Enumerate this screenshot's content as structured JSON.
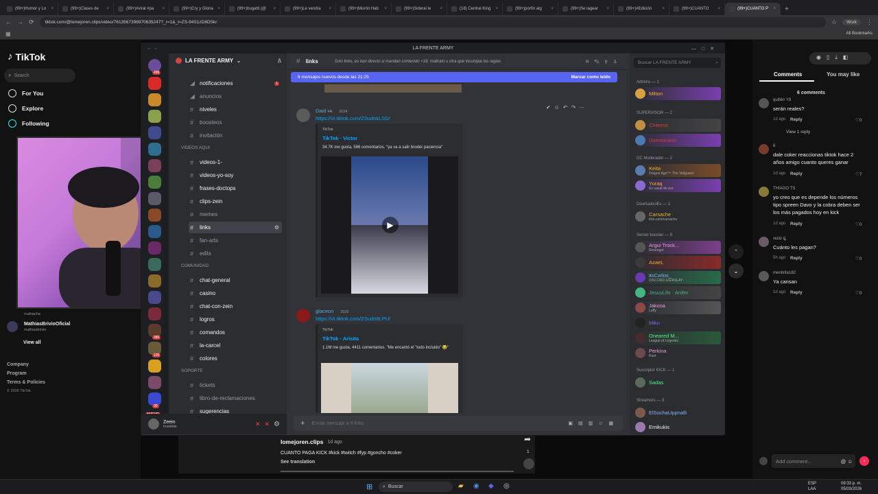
{
  "browser": {
    "tabs": [
      {
        "label": "(99+)Humor y Lo"
      },
      {
        "label": "(99+)Clases de"
      },
      {
        "label": "(99+)#viral #pa"
      },
      {
        "label": "(99+)Cry y Gloria"
      },
      {
        "label": "(99+)bugatti (@"
      },
      {
        "label": "(99+)Le vendía"
      },
      {
        "label": "(99+)Murón Hab"
      },
      {
        "label": "(99+)Sideral le"
      },
      {
        "label": "(18) Central King"
      },
      {
        "label": "(99+)porfin alg"
      },
      {
        "label": "(99+)Se lagear"
      },
      {
        "label": "(99+)#Edición"
      },
      {
        "label": "(99+)CUANTO"
      },
      {
        "label": "(99+)CUANTO P"
      }
    ],
    "url": "tiktok.com/@lomejoren.clips/video/7613567396970635247?_r=1&_t=ZS-94S1zD8DSkr",
    "profile_label": "Work",
    "bookmarks_label": "All Bookmarks"
  },
  "tiktok": {
    "logo": "TikTok",
    "search_placeholder": "Search",
    "nav": {
      "foryou": "For You",
      "explore": "Explore",
      "following": "Following"
    },
    "account": {
      "name": "MathiasBrivioOficial",
      "handle": "mathiasbrivio",
      "handle_above": "rcalnacha"
    },
    "view_all": "View all",
    "footer": {
      "company": "Company",
      "program": "Program",
      "terms": "Terms & Policies",
      "copyright": "© 2026 TikTok"
    },
    "video": {
      "author": "lomejoren.clips",
      "age": "1d ago",
      "caption": "CUANTO PAGA KICK #kick #twitch #fyp #goncho #coker",
      "translation": "See translation",
      "share_count": "1"
    },
    "panel_tabs": {
      "comments": "Comments",
      "may_like": "You may like"
    },
    "comment_count": "6 comments",
    "comments": [
      {
        "user": "quillén Y8",
        "text": "serán reales?",
        "time": "1d ago",
        "reply": "Reply",
        "likes": "0",
        "view_replies": "View 1 reply"
      },
      {
        "user": "6",
        "text": "dale coker reaccionas tiktok hace 2 años amigo cuanto queres ganar",
        "time": "1d ago",
        "reply": "Reply",
        "likes": "7"
      },
      {
        "user": "THIAGO TS",
        "text": "yo creo que es depende los números tipo spreen Davo y la cobra deben ser los más pagados hoy en kick",
        "time": "1d ago",
        "reply": "Reply",
        "likes": "0"
      },
      {
        "user": "ʌɛɛɪɪ ȡ",
        "text": "Cuánto les pagan?",
        "time": "5h ago",
        "reply": "Reply",
        "likes": "0"
      },
      {
        "user": "mentirita182",
        "text": "Ya cansan",
        "time": "1d ago",
        "reply": "Reply",
        "likes": "0"
      }
    ],
    "add_comment": "Add comment..."
  },
  "discord": {
    "title": "LA FRENTE ARMY",
    "server_name": "LA FRENTE ARMY",
    "server_badges": [
      {
        "label": "496"
      },
      {
        "label": "386"
      },
      {
        "label": "105"
      },
      {
        "label": "30"
      },
      {
        "label": "NUEVO"
      },
      {
        "label": "3"
      }
    ],
    "channels_top": [
      {
        "name": "notificaciones",
        "badge": "1"
      },
      {
        "name": "anuncios"
      },
      {
        "name": "niveles"
      },
      {
        "name": "boosteos"
      },
      {
        "name": "invitación"
      }
    ],
    "cat_videos": "VIDEOS AQUI",
    "channels_videos": [
      {
        "name": "videos-1-"
      },
      {
        "name": "videos-yo-soy"
      },
      {
        "name": "frases-doctops"
      },
      {
        "name": "clips-zein"
      },
      {
        "name": "memes"
      },
      {
        "name": "links"
      },
      {
        "name": "fan-arts"
      },
      {
        "name": "edits"
      }
    ],
    "cat_comunidad": "COMUNIDAD",
    "channels_comunidad": [
      {
        "name": "chat-general"
      },
      {
        "name": "casino"
      },
      {
        "name": "chat-con-zein"
      },
      {
        "name": "logros"
      },
      {
        "name": "comandos"
      },
      {
        "name": "la-carcel"
      },
      {
        "name": "colores"
      }
    ],
    "cat_soporte": "SOPORTE",
    "channels_soporte": [
      {
        "name": "tickets"
      },
      {
        "name": "libro-de-reclamaciones"
      },
      {
        "name": "sugerencias"
      }
    ],
    "user": {
      "name": "Zeein",
      "status": "Invisible"
    },
    "channel_header": {
      "name": "links",
      "topic": "Solo links, es ban directo si mandan contenido +18, maltrato u otra que incumpla las reglas"
    },
    "search_placeholder": "Buscar LA FRENTE ARMY",
    "new_messages": "6 mensajes nuevos desde las 21:25",
    "mark_read": "Marcar como leído",
    "messages": [
      {
        "author": "Daid",
        "tag": "FA",
        "year": "2024",
        "link": "https://vt.tiktok.com/ZSudnkLSD/",
        "provider": "TikTok",
        "embed_title": "TikTok · Victor",
        "embed_desc": "34.7K me gusta, 586 comentarios. \"ya va a salir broder paciencia\""
      },
      {
        "author": "glaceon",
        "year": "2025",
        "link": "https://vt.tiktok.com/ZSudn8LPU/",
        "provider": "TikTok",
        "embed_title": "TikTok · Arisita",
        "embed_desc": "1.1M me gusta, 4411 comentarios. \"Me encantó el \"todo incluido\" 😂\""
      }
    ],
    "composer_placeholder": "Enviar mensaje a # links",
    "member_groups": [
      {
        "title": "Admins — 1",
        "members": [
          {
            "name": "Milton",
            "color": "#f0b232"
          }
        ]
      },
      {
        "title": "SUPERVISOR — 2",
        "members": [
          {
            "name": "Cheemo",
            "color": "#e03b3b"
          },
          {
            "name": "Dominicano",
            "color": "#e03b3b"
          }
        ]
      },
      {
        "title": "DC Moderador — 2",
        "members": [
          {
            "name": "Keita",
            "color": "#f0b232",
            "sub": "Dragon Age™: The Veilguard"
          },
          {
            "name": "Yuraq",
            "color": "#f0b232",
            "sub": "En canal de voz"
          }
        ]
      },
      {
        "title": "DiseñadorÆs — 1",
        "members": [
          {
            "name": "Carsache",
            "color": "#f0b232",
            "sub": "kick.com/carsache"
          }
        ]
      },
      {
        "title": "Server booster — 8",
        "members": [
          {
            "name": "Argui Trock...",
            "color": "#e9a0e0",
            "sub": "Revenger"
          },
          {
            "name": "AzaeL",
            "color": "#f0b232"
          },
          {
            "name": "itsCxrlos_",
            "color": "#8ab4f8",
            "sub": "DISCORD.GG/ASLAY"
          },
          {
            "name": "JesusLife · Anifer",
            "color": "#43b581"
          },
          {
            "name": "Jakosa",
            "color": "#e9a0e0",
            "sub": "Luffy"
          },
          {
            "name": "Miku",
            "color": "#7b68ee"
          },
          {
            "name": "Oneared M...",
            "color": "#57f287",
            "sub": "League of Legends"
          },
          {
            "name": "Perkina",
            "color": "#e9a0e0",
            "sub": "Rust"
          }
        ]
      },
      {
        "title": "Suscriptor KICK — 1",
        "members": [
          {
            "name": "Sadas",
            "color": "#57f287"
          }
        ]
      },
      {
        "title": "Streamers — 3",
        "members": [
          {
            "name": "ElSochaUppnalli",
            "color": "#8ab4f8"
          },
          {
            "name": "Emikukis",
            "color": "#f2f3f5"
          }
        ]
      }
    ]
  },
  "taskbar": {
    "search": "Buscar",
    "lang": "ESP",
    "lang2": "LAA",
    "time": "09:33 p. m.",
    "date": "05/03/2026"
  },
  "colors": {
    "blurple": "#5865f2",
    "link": "#00a8fc",
    "tiktok_red": "#fe2c55"
  }
}
